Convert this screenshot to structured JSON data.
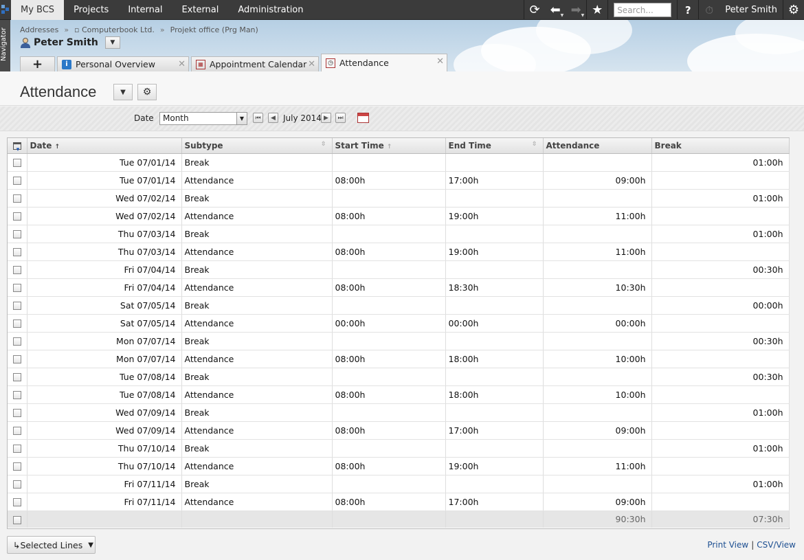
{
  "topnav": {
    "menu": [
      "My BCS",
      "Projects",
      "Internal",
      "External",
      "Administration"
    ],
    "search_placeholder": "Search...",
    "help_label": "?",
    "user": "Peter Smith"
  },
  "navigator_label": "Navigator",
  "breadcrumb": [
    "Addresses",
    "Computerbook Ltd.",
    "Projekt office (Prg Man)"
  ],
  "breadcrumb_sep": "»",
  "person_name": "Peter Smith",
  "tabs": {
    "add_label": "+",
    "items": [
      {
        "label": "Personal Overview"
      },
      {
        "label": "Appointment Calendar"
      },
      {
        "label": "Attendance"
      }
    ]
  },
  "page_title": "Attendance",
  "filter": {
    "label": "Date",
    "period": "Month",
    "current": "July 2014"
  },
  "table": {
    "columns": [
      "Date",
      "Subtype",
      "Start Time",
      "End Time",
      "Attendance",
      "Break"
    ],
    "rows": [
      [
        "Tue 07/01/14",
        "Break",
        "",
        "",
        "",
        "01:00h"
      ],
      [
        "Tue 07/01/14",
        "Attendance",
        "08:00h",
        "17:00h",
        "09:00h",
        ""
      ],
      [
        "Wed 07/02/14",
        "Break",
        "",
        "",
        "",
        "01:00h"
      ],
      [
        "Wed 07/02/14",
        "Attendance",
        "08:00h",
        "19:00h",
        "11:00h",
        ""
      ],
      [
        "Thu 07/03/14",
        "Break",
        "",
        "",
        "",
        "01:00h"
      ],
      [
        "Thu 07/03/14",
        "Attendance",
        "08:00h",
        "19:00h",
        "11:00h",
        ""
      ],
      [
        "Fri 07/04/14",
        "Break",
        "",
        "",
        "",
        "00:30h"
      ],
      [
        "Fri 07/04/14",
        "Attendance",
        "08:00h",
        "18:30h",
        "10:30h",
        ""
      ],
      [
        "Sat 07/05/14",
        "Break",
        "",
        "",
        "",
        "00:00h"
      ],
      [
        "Sat 07/05/14",
        "Attendance",
        "00:00h",
        "00:00h",
        "00:00h",
        ""
      ],
      [
        "Mon 07/07/14",
        "Break",
        "",
        "",
        "",
        "00:30h"
      ],
      [
        "Mon 07/07/14",
        "Attendance",
        "08:00h",
        "18:00h",
        "10:00h",
        ""
      ],
      [
        "Tue 07/08/14",
        "Break",
        "",
        "",
        "",
        "00:30h"
      ],
      [
        "Tue 07/08/14",
        "Attendance",
        "08:00h",
        "18:00h",
        "10:00h",
        ""
      ],
      [
        "Wed 07/09/14",
        "Break",
        "",
        "",
        "",
        "01:00h"
      ],
      [
        "Wed 07/09/14",
        "Attendance",
        "08:00h",
        "17:00h",
        "09:00h",
        ""
      ],
      [
        "Thu 07/10/14",
        "Break",
        "",
        "",
        "",
        "01:00h"
      ],
      [
        "Thu 07/10/14",
        "Attendance",
        "08:00h",
        "19:00h",
        "11:00h",
        ""
      ],
      [
        "Fri 07/11/14",
        "Break",
        "",
        "",
        "",
        "01:00h"
      ],
      [
        "Fri 07/11/14",
        "Attendance",
        "08:00h",
        "17:00h",
        "09:00h",
        ""
      ]
    ],
    "totals": {
      "attendance": "90:30h",
      "break": "07:30h"
    }
  },
  "footer": {
    "selected_lines": "Selected Lines",
    "print_view": "Print View",
    "csv_view": "CSV/View",
    "link_sep": "|"
  }
}
